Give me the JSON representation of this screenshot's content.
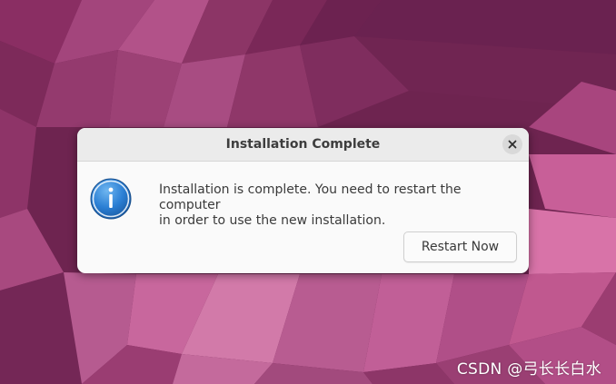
{
  "dialog": {
    "title": "Installation Complete",
    "message_line1": "Installation is complete. You need to restart the computer",
    "message_line2": "in order to use the new installation.",
    "restart_button": "Restart Now",
    "close_icon": "close-icon",
    "info_icon": "info-icon"
  },
  "watermark": {
    "text": "CSDN @弓长长白水"
  },
  "colors": {
    "wallpaper_base": "#6e2450",
    "wallpaper_light": "#c2588f",
    "info_icon_blue": "#2b7fd4",
    "dialog_bg": "#fafafa",
    "titlebar_bg": "#ebebeb"
  }
}
